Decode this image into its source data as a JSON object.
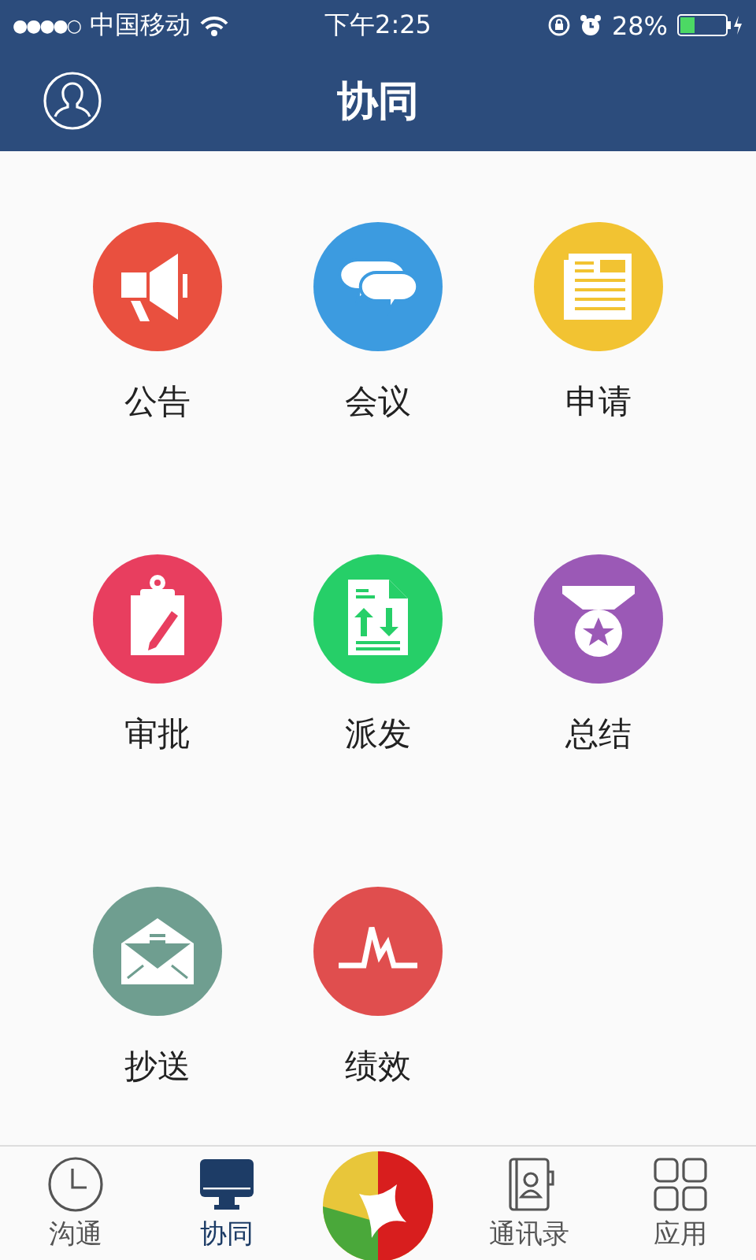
{
  "status_bar": {
    "signal": "●●●●○",
    "carrier": "中国移动",
    "time": "下午2:25",
    "battery": "28%"
  },
  "nav_bar": {
    "title": "协同"
  },
  "apps": [
    {
      "label": "公告",
      "kind": "megaphone",
      "color": "#e9503f"
    },
    {
      "label": "会议",
      "kind": "chat",
      "color": "#3c9be0"
    },
    {
      "label": "申请",
      "kind": "newspaper",
      "color": "#f2c332"
    },
    {
      "label": "审批",
      "kind": "clipboard",
      "color": "#e83e5f"
    },
    {
      "label": "派发",
      "kind": "document",
      "color": "#26cf68"
    },
    {
      "label": "总结",
      "kind": "medal",
      "color": "#9b59b6"
    },
    {
      "label": "抄送",
      "kind": "envelope",
      "color": "#6f9e90"
    },
    {
      "label": "绩效",
      "kind": "pulse",
      "color": "#e04e4e"
    }
  ],
  "tabs": [
    {
      "label": "沟通",
      "kind": "clock",
      "selected": false
    },
    {
      "label": "协同",
      "kind": "monitor",
      "selected": true
    },
    {
      "kind": "logo",
      "selected": false
    },
    {
      "label": "通讯录",
      "kind": "contacts",
      "selected": false
    },
    {
      "label": "应用",
      "kind": "grid",
      "selected": false
    }
  ]
}
